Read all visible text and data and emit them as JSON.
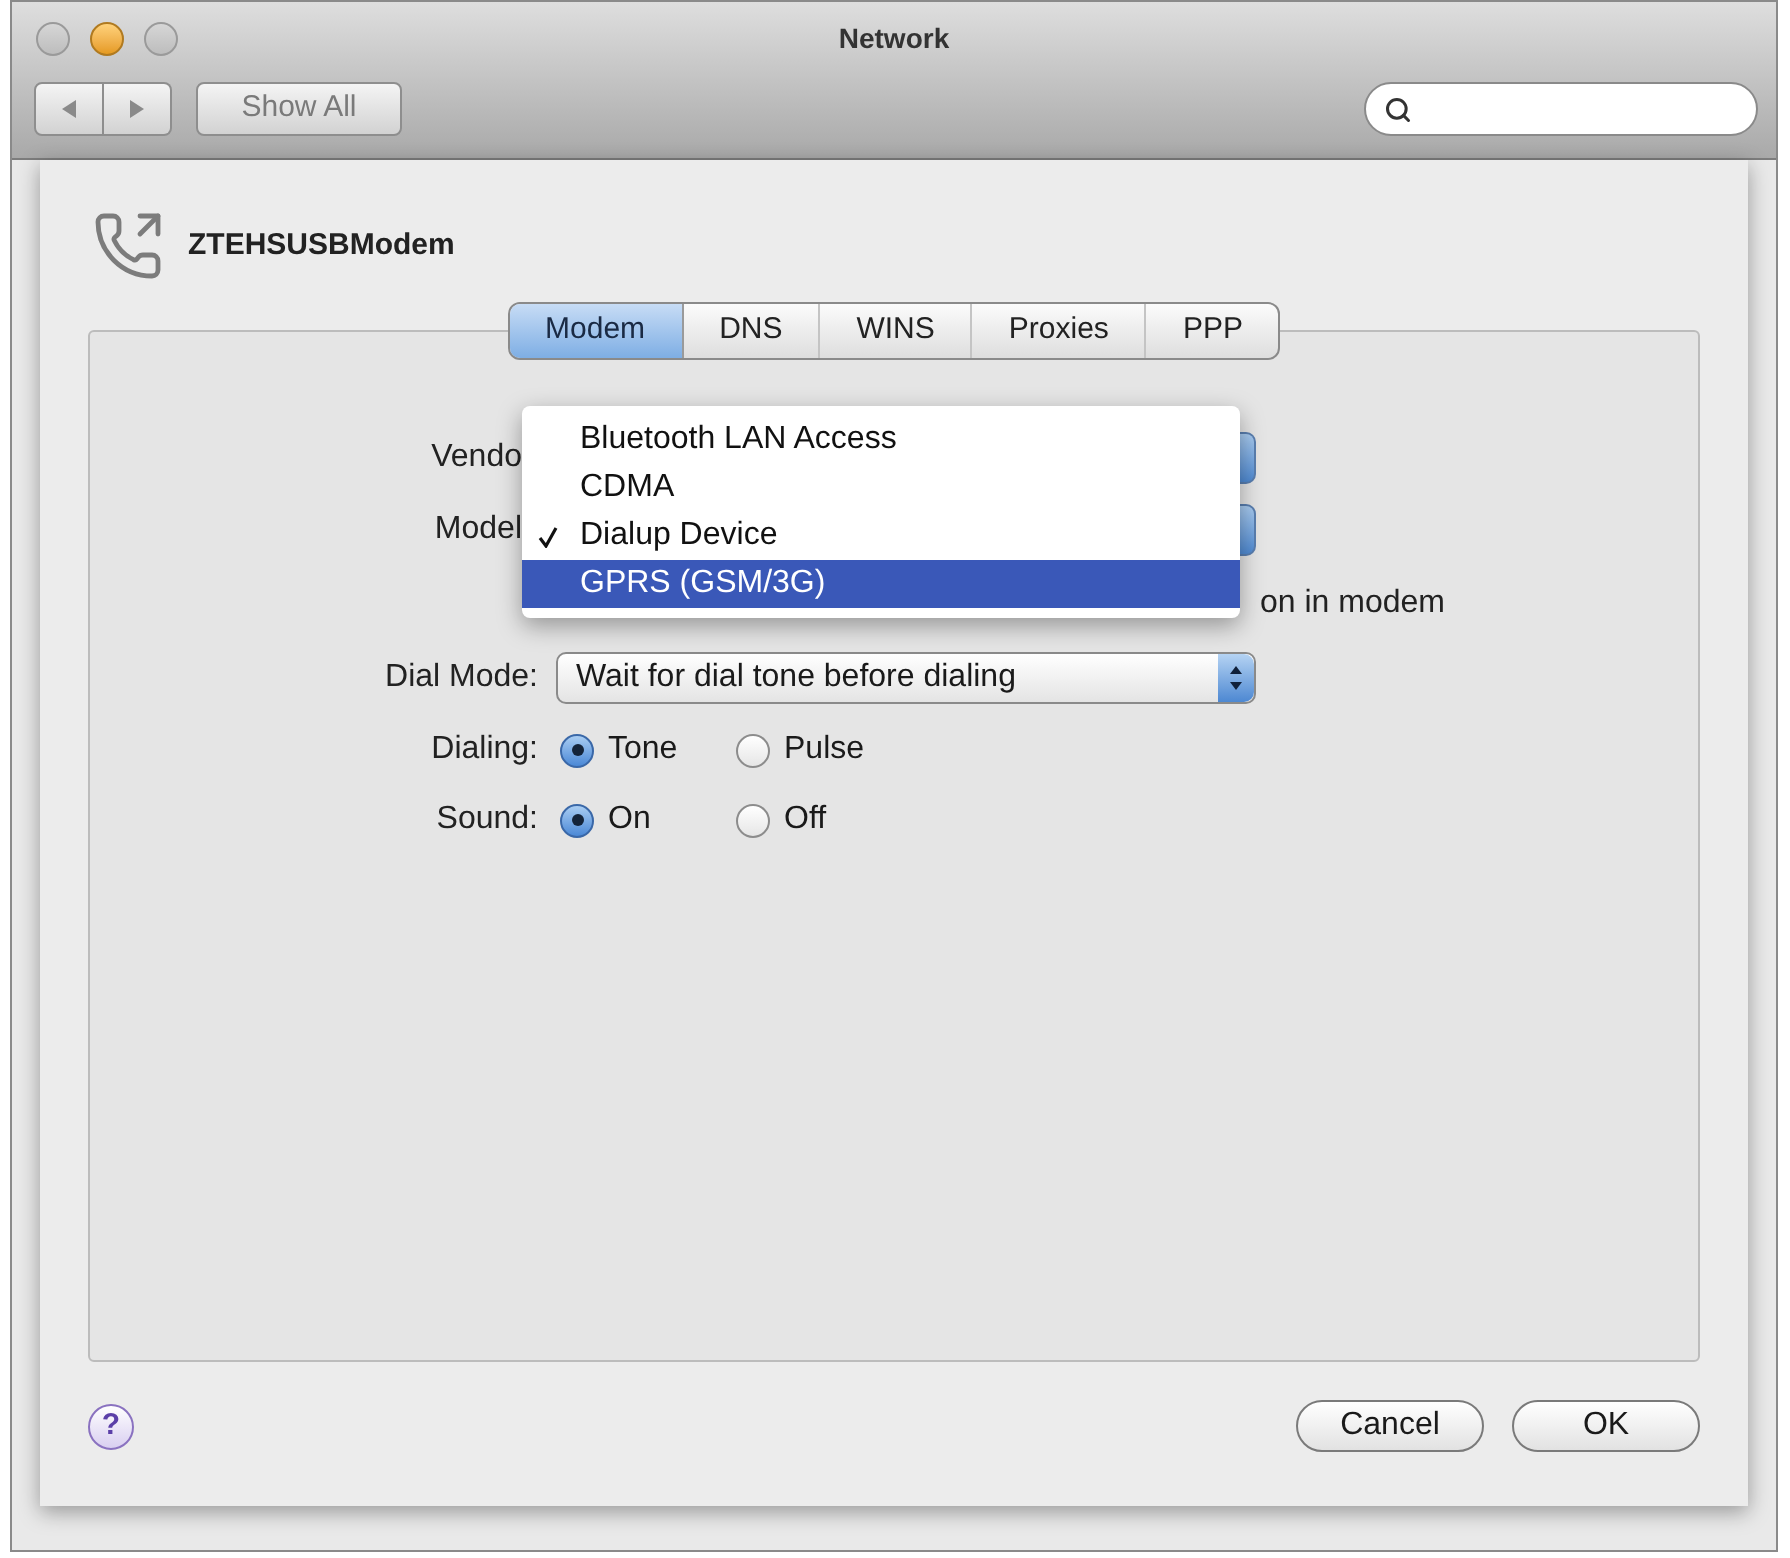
{
  "window": {
    "title": "Network"
  },
  "toolbar": {
    "show_all": "Show All"
  },
  "sheet": {
    "interface_name": "ZTEHSUSBModem",
    "tabs": [
      {
        "label": "Modem",
        "selected": true
      },
      {
        "label": "DNS",
        "selected": false
      },
      {
        "label": "WINS",
        "selected": false
      },
      {
        "label": "Proxies",
        "selected": false
      },
      {
        "label": "PPP",
        "selected": false
      }
    ],
    "form": {
      "vendor": {
        "label": "Vendo"
      },
      "model": {
        "label": "Model"
      },
      "modem_option": {
        "label": "on in modem"
      },
      "dial_mode": {
        "label": "Dial Mode:",
        "value": "Wait for dial tone before dialing"
      },
      "dialing": {
        "label": "Dialing:",
        "options": [
          {
            "label": "Tone",
            "selected": true
          },
          {
            "label": "Pulse",
            "selected": false
          }
        ]
      },
      "sound": {
        "label": "Sound:",
        "options": [
          {
            "label": "On",
            "selected": true
          },
          {
            "label": "Off",
            "selected": false
          }
        ]
      }
    },
    "model_menu": {
      "items": [
        {
          "label": "Bluetooth LAN Access",
          "checked": false,
          "selected": false
        },
        {
          "label": "CDMA",
          "checked": false,
          "selected": false
        },
        {
          "label": "Dialup Device",
          "checked": true,
          "selected": false
        },
        {
          "label": "GPRS (GSM/3G)",
          "checked": false,
          "selected": true
        }
      ]
    },
    "help": "?",
    "buttons": [
      {
        "label": "Cancel"
      },
      {
        "label": "OK"
      }
    ]
  }
}
